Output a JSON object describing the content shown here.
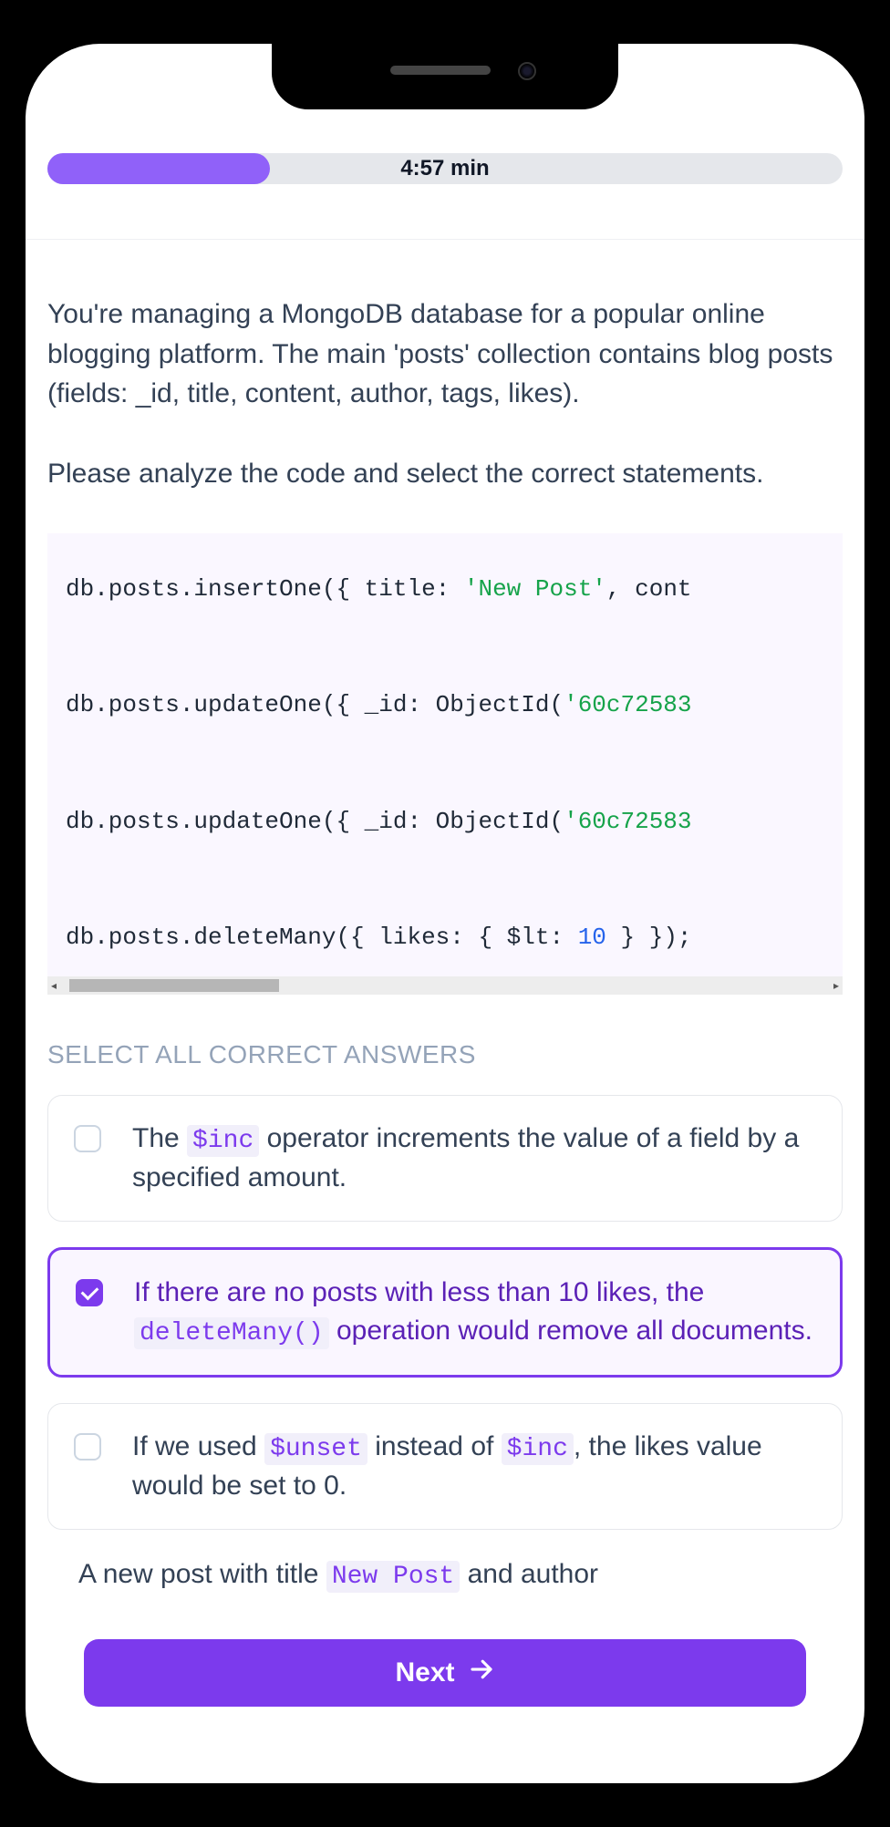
{
  "timer": "4:57 min",
  "progress_percent": 28,
  "prompt_p1": "You're managing a MongoDB database for a popular online blogging platform. The main 'posts' collection contains blog posts (fields: _id, title, content, author, tags, likes).",
  "prompt_p2": "Please analyze the code and select the correct statements.",
  "code": {
    "l1a": "db.posts.insertOne({ title: ",
    "l1b": "'New Post'",
    "l1c": ", cont",
    "l2a": "db.posts.updateOne({ _id: ObjectId(",
    "l2b": "'60c72583",
    "l3a": "db.posts.updateOne({ _id: ObjectId(",
    "l3b": "'60c72583",
    "l4a": "db.posts.deleteMany({ likes: { $lt: ",
    "l4b": "10",
    "l4c": " } });"
  },
  "section_title": "SELECT ALL CORRECT ANSWERS",
  "answers": [
    {
      "pre": "The ",
      "code": "$inc",
      "post": " operator increments the value of a field by a specified amount.",
      "selected": false
    },
    {
      "pre": "If there are no posts with less than 10 likes, the ",
      "code": "deleteMany()",
      "post": " operation would remove all documents.",
      "selected": true
    },
    {
      "pre": "If we used ",
      "code": "$unset",
      "mid": " instead of ",
      "code2": "$inc",
      "post": ", the likes value would be set to 0.",
      "selected": false
    }
  ],
  "partial": {
    "pre": "A new post with title ",
    "code": "New Post",
    "post": " and author"
  },
  "next_label": "Next"
}
